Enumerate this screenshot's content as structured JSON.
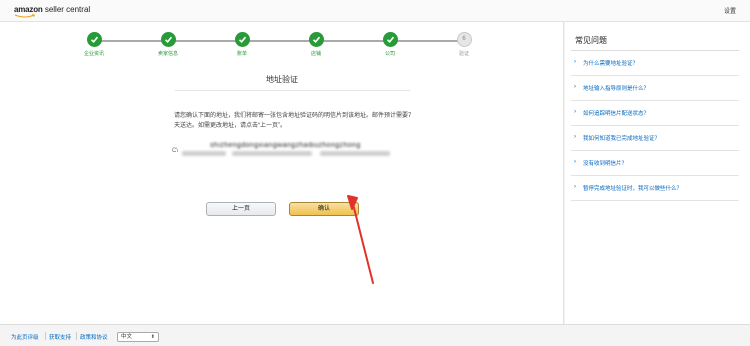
{
  "header": {
    "logo_brand": "amazon",
    "logo_rest": " seller central",
    "settings_label": "设置"
  },
  "stepper": {
    "steps": [
      {
        "label": "企业资讯",
        "state": "done"
      },
      {
        "label": "卖家信息",
        "state": "done"
      },
      {
        "label": "账单",
        "state": "done"
      },
      {
        "label": "店铺",
        "state": "done"
      },
      {
        "label": "公司",
        "state": "done"
      },
      {
        "label": "验证",
        "state": "pending",
        "number": "6"
      }
    ]
  },
  "main": {
    "title": "地址验证",
    "message": "请您确认下面的地址，我们将邮寄一张包含地址验证码的明信片到该地址。邮件预计需要7天送达。如需更改地址，请点击“上一页”。",
    "address_text": "shizhengdongxiangwangzhaibuzhongzhong",
    "prev_button": "上一页",
    "confirm_button": "确认"
  },
  "sidebar": {
    "title": "常见问题",
    "faq": [
      "为什么需要地址验证？",
      "地址输入指导原则是什么？",
      "如何追踪明信片配送状态？",
      "我如何知道我已完成地址验证？",
      "没有收到明信片？",
      "暂停完成地址验证时，我可以做些什么？"
    ]
  },
  "footer": {
    "links": [
      "为此页评级",
      "获取支持",
      "政策和协议"
    ],
    "language": "中文"
  },
  "colors": {
    "step_done": "#279b37",
    "link": "#0066c0",
    "confirm_bg": "#f0c14b",
    "arrow": "#e0322b"
  }
}
